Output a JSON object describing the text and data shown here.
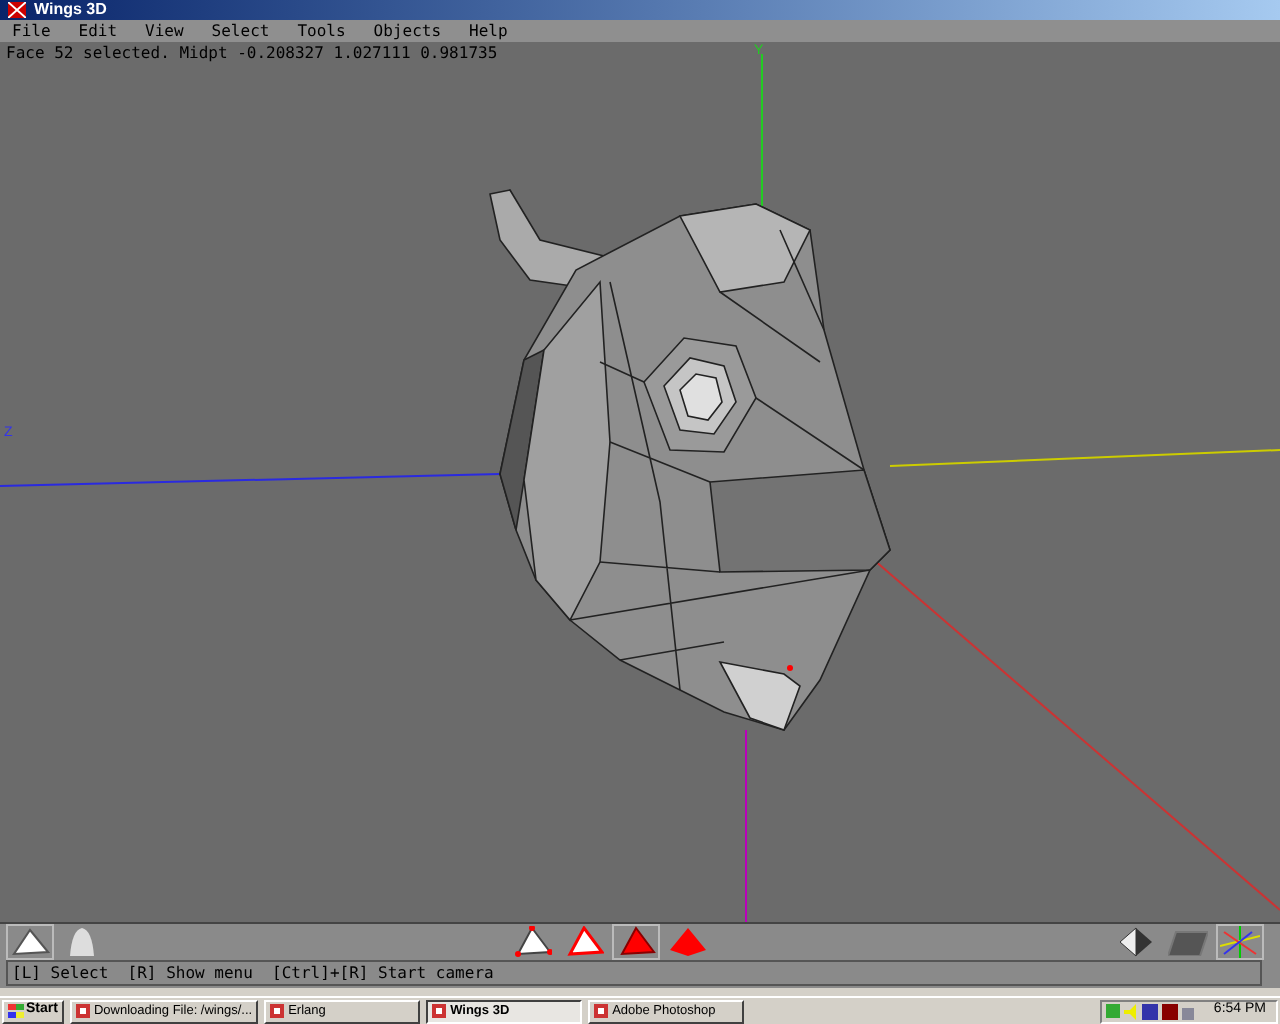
{
  "window": {
    "title": "Wings 3D"
  },
  "menu": [
    "File",
    "Edit",
    "View",
    "Select",
    "Tools",
    "Objects",
    "Help"
  ],
  "status_text": "Face 52 selected. Midpt -0.208327 1.027111 0.981735",
  "axis_labels": [
    {
      "kind": "y",
      "label": "Y"
    },
    {
      "kind": "z",
      "label": "Z"
    }
  ],
  "toolbar": {
    "left": [
      {
        "kind": "flat",
        "selected": true
      },
      {
        "kind": "smooth",
        "selected": false
      }
    ],
    "select_modes": [
      {
        "kind": "vertex",
        "selected": false
      },
      {
        "kind": "edge",
        "selected": false
      },
      {
        "kind": "face",
        "selected": true
      },
      {
        "kind": "body",
        "selected": false
      }
    ],
    "right": [
      {
        "kind": "solid",
        "selected": false
      },
      {
        "kind": "ground",
        "selected": false
      },
      {
        "kind": "axes",
        "selected": true
      }
    ]
  },
  "help_line": "[L] Select  [R] Show menu  [Ctrl]+[R] Start camera",
  "taskbar": {
    "start": "Start",
    "tasks": [
      {
        "label": "Downloading File: /wings/...",
        "selected": false
      },
      {
        "label": "Erlang",
        "selected": false
      },
      {
        "label": "Wings 3D",
        "selected": true
      },
      {
        "label": "Adobe Photoshop",
        "selected": false
      }
    ],
    "clock": "6:54 PM"
  }
}
